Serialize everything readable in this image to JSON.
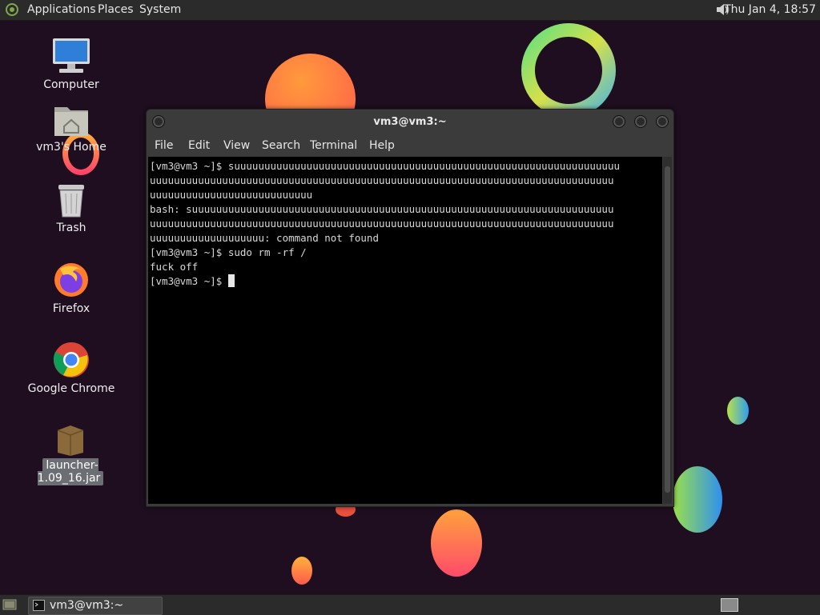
{
  "top_panel": {
    "menus": [
      "Applications",
      "Places",
      "System"
    ],
    "clock": "Thu Jan  4, 18:57"
  },
  "desktop": {
    "icons": [
      {
        "label": "Computer"
      },
      {
        "label": "vm3's Home"
      },
      {
        "label": "Trash"
      },
      {
        "label": "Firefox"
      },
      {
        "label": "Google Chrome"
      },
      {
        "label": "launcher-1.09_16.jar"
      }
    ]
  },
  "terminal": {
    "title": "vm3@vm3:~",
    "menu": [
      "File",
      "Edit",
      "View",
      "Search",
      "Terminal",
      "Help"
    ],
    "lines": [
      "[vm3@vm3 ~]$ suuuuuuuuuuuuuuuuuuuuuuuuuuuuuuuuuuuuuuuuuuuuuuuuuuuuuuuuuuuuuuuu",
      "uuuuuuuuuuuuuuuuuuuuuuuuuuuuuuuuuuuuuuuuuuuuuuuuuuuuuuuuuuuuuuuuuuuuuuuuuuuuu",
      "uuuuuuuuuuuuuuuuuuuuuuuuuuu",
      "bash: suuuuuuuuuuuuuuuuuuuuuuuuuuuuuuuuuuuuuuuuuuuuuuuuuuuuuuuuuuuuuuuuuuuuuu",
      "uuuuuuuuuuuuuuuuuuuuuuuuuuuuuuuuuuuuuuuuuuuuuuuuuuuuuuuuuuuuuuuuuuuuuuuuuuuuu",
      "uuuuuuuuuuuuuuuuuuu: command not found",
      "[vm3@vm3 ~]$ sudo rm -rf /",
      "fuck off"
    ],
    "prompt": "[vm3@vm3 ~]$ "
  },
  "bottom_panel": {
    "task_label": "vm3@vm3:~"
  },
  "colors": {
    "background": "#1e0e1f",
    "panel": "#2b2b2b",
    "terminal_bg": "#000000"
  }
}
